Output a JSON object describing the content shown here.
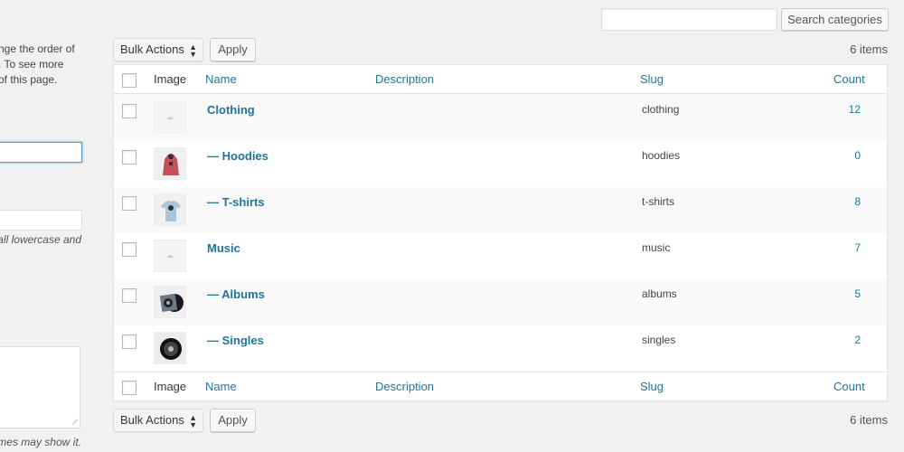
{
  "form": {
    "description_lines": [
      "nge the order of",
      ". To see more",
      "of this page."
    ],
    "name_value": "",
    "slug_value": "",
    "slug_help": "all lowercase and",
    "description_value": "",
    "description_help": "mes may show it."
  },
  "search": {
    "input_value": "",
    "button_label": "Search categories"
  },
  "tablenav_top": {
    "bulk_actions": "Bulk Actions",
    "apply": "Apply",
    "count": "6 items"
  },
  "tablenav_bottom": {
    "bulk_actions": "Bulk Actions",
    "apply": "Apply",
    "count": "6 items"
  },
  "table": {
    "columns": {
      "image": "Image",
      "name": "Name",
      "description": "Description",
      "slug": "Slug",
      "count": "Count"
    },
    "rows": [
      {
        "name": "Clothing",
        "slug": "clothing",
        "count": "12",
        "thumbnail": "placeholder-icon",
        "description": ""
      },
      {
        "name": "— Hoodies",
        "slug": "hoodies",
        "count": "0",
        "thumbnail": "hoodie-image",
        "description": ""
      },
      {
        "name": "— T-shirts",
        "slug": "t-shirts",
        "count": "8",
        "thumbnail": "tshirt-image",
        "description": ""
      },
      {
        "name": "Music",
        "slug": "music",
        "count": "7",
        "thumbnail": "placeholder-icon",
        "description": ""
      },
      {
        "name": "— Albums",
        "slug": "albums",
        "count": "5",
        "thumbnail": "album-image",
        "description": ""
      },
      {
        "name": "— Singles",
        "slug": "singles",
        "count": "2",
        "thumbnail": "single-image",
        "description": ""
      }
    ]
  }
}
